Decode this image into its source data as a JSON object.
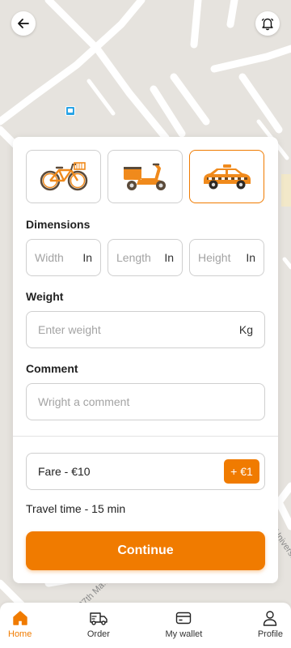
{
  "map": {
    "street_labels": [
      "27th Ma...",
      "Univers..."
    ]
  },
  "header": {
    "back_icon": "arrow-left-icon",
    "bell_icon": "bell-icon"
  },
  "vehicles": [
    {
      "type": "bicycle",
      "icon": "bicycle-icon",
      "selected": false
    },
    {
      "type": "scooter",
      "icon": "scooter-icon",
      "selected": false
    },
    {
      "type": "taxi",
      "icon": "taxi-icon",
      "selected": true
    }
  ],
  "dimensions": {
    "label": "Dimensions",
    "width": {
      "placeholder": "Width",
      "unit": "In"
    },
    "length": {
      "placeholder": "Length",
      "unit": "In"
    },
    "height": {
      "placeholder": "Height",
      "unit": "In"
    }
  },
  "weight": {
    "label": "Weight",
    "placeholder": "Enter weight",
    "unit": "Kg"
  },
  "comment": {
    "label": "Comment",
    "placeholder": "Wright a comment"
  },
  "fare": {
    "text": "Fare - €10",
    "tip_label": "+ €1"
  },
  "travel_time": "Travel time - 15 min",
  "continue_label": "Continue",
  "accent_color": "#f07b00",
  "nav": [
    {
      "label": "Home",
      "icon": "home-icon",
      "active": true
    },
    {
      "label": "Order",
      "icon": "truck-icon",
      "active": false
    },
    {
      "label": "My wallet",
      "icon": "wallet-icon",
      "active": false
    },
    {
      "label": "Profile",
      "icon": "user-icon",
      "active": false
    }
  ]
}
